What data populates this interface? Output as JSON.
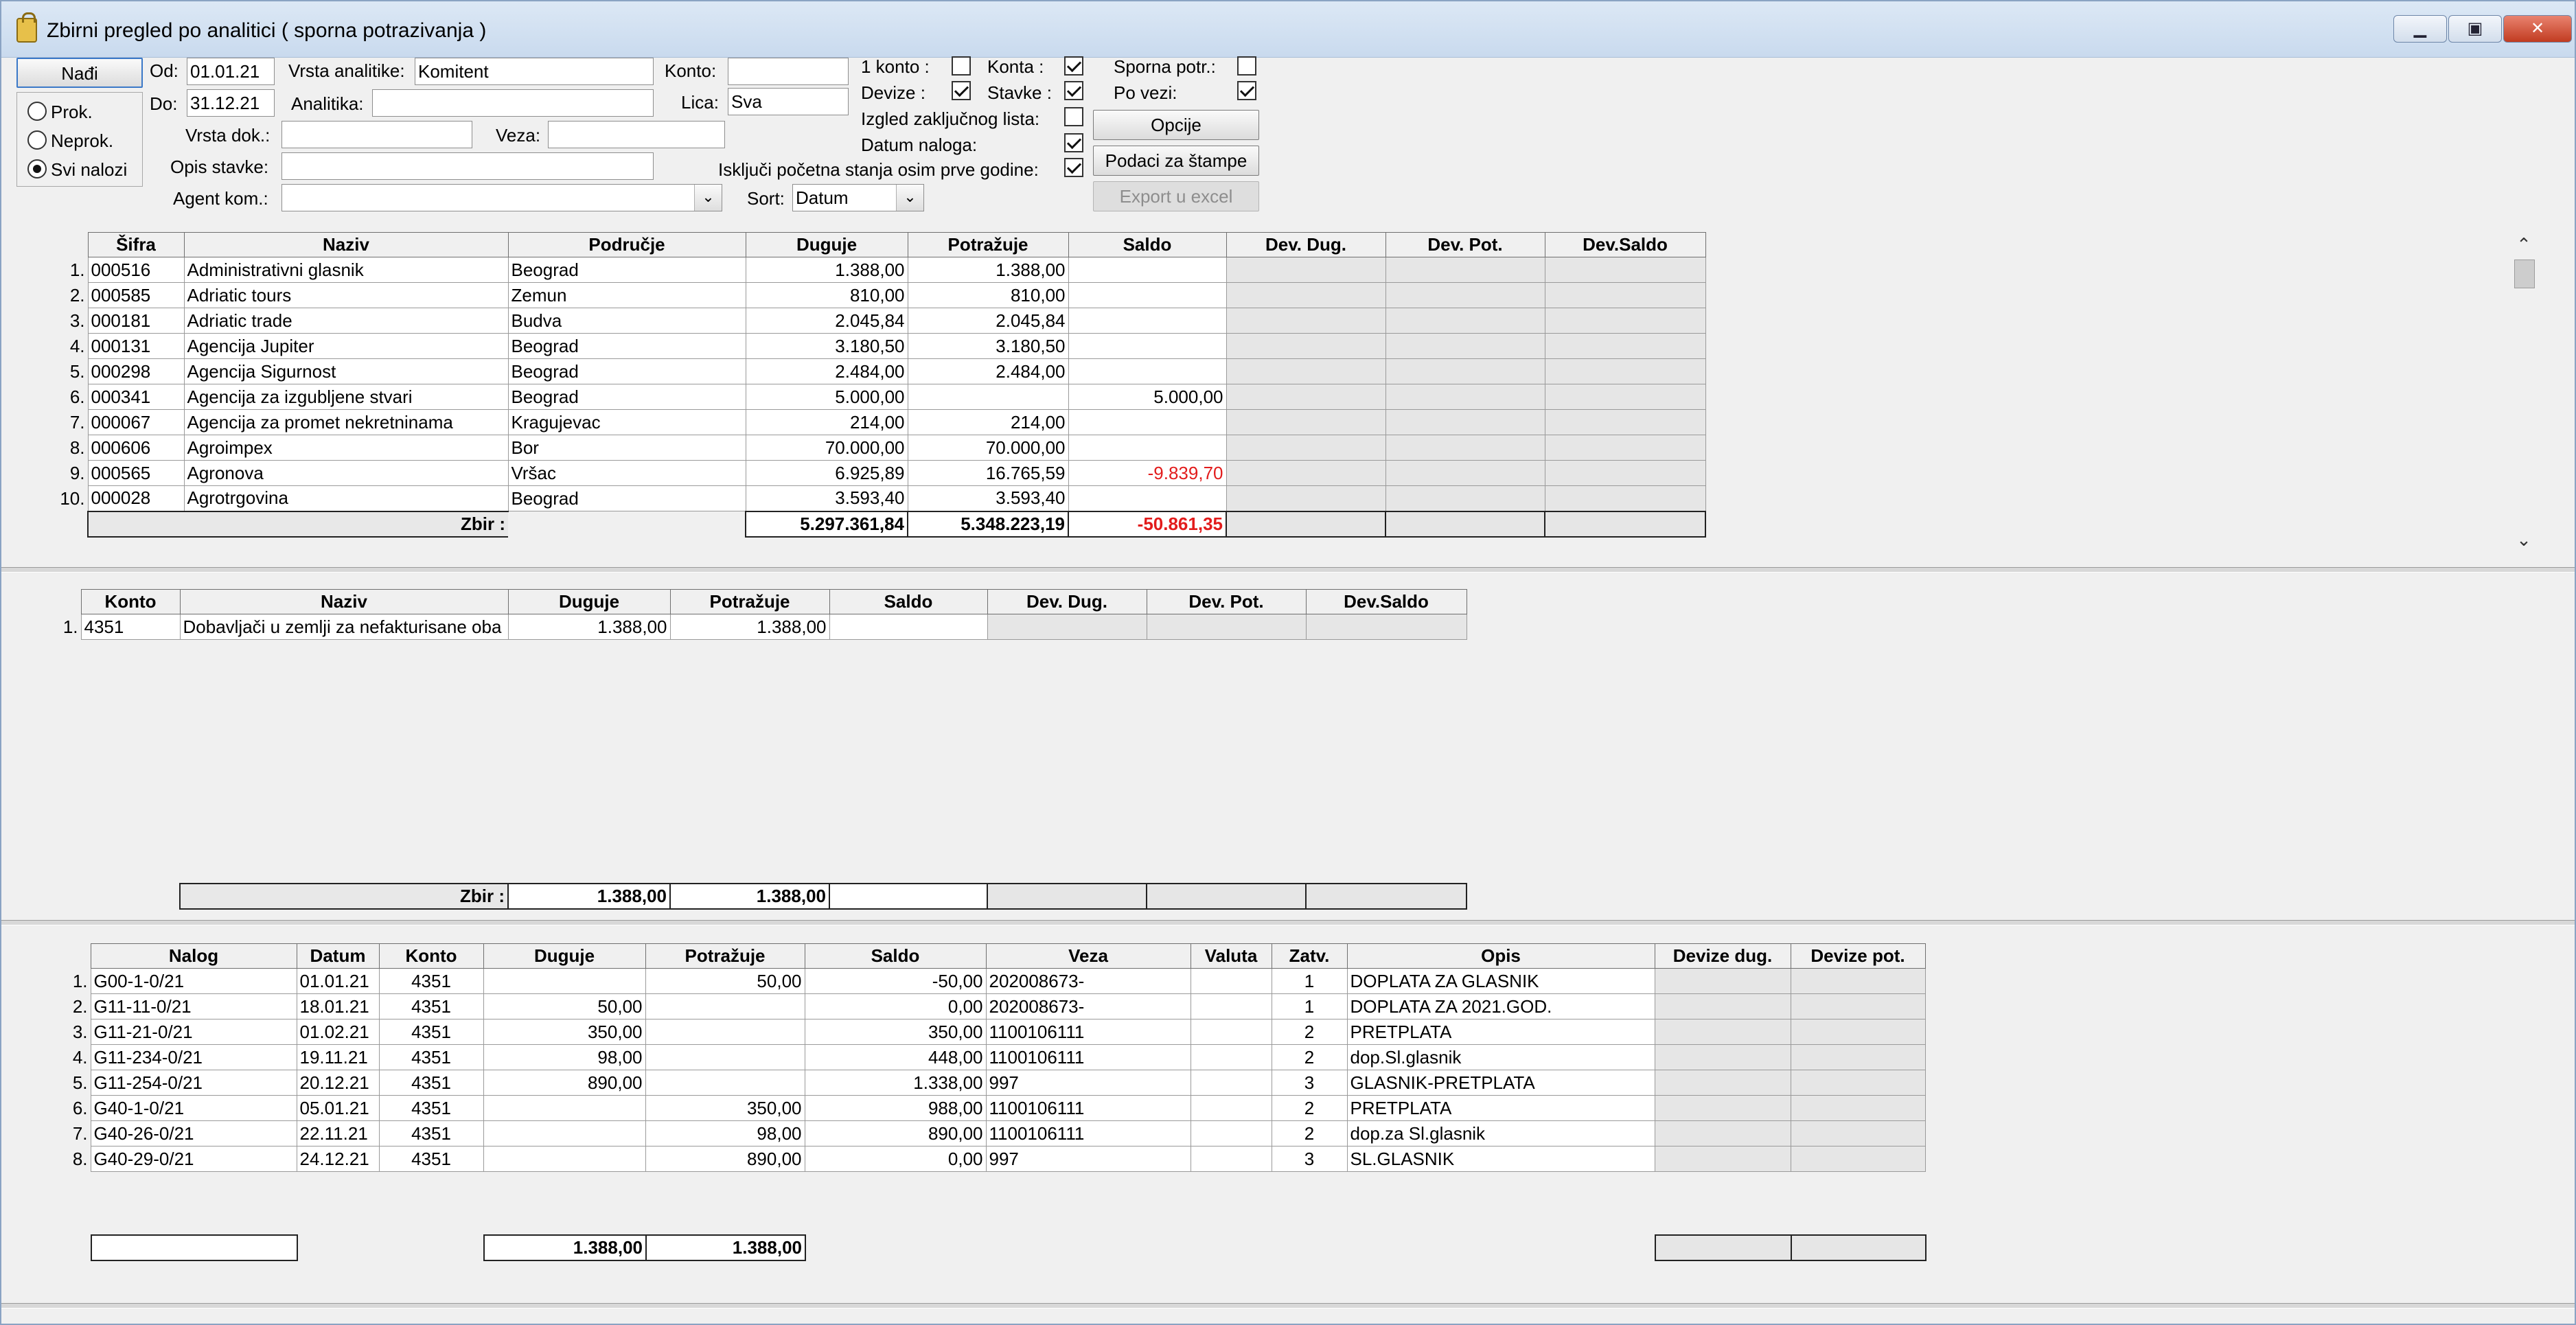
{
  "window": {
    "title": "Zbirni pregled po analitici  ( sporna potrazivanja )",
    "controls": [
      "minimize-icon",
      "maximize-icon",
      "close-icon"
    ]
  },
  "filters": {
    "find_button": "Nađi",
    "od_label": "Od:",
    "od_value": "01.01.21",
    "do_label": "Do:",
    "do_value": "31.12.21",
    "radios": [
      {
        "label": "Prok.",
        "checked": false
      },
      {
        "label": "Neprok.",
        "checked": false
      },
      {
        "label": "Svi nalozi",
        "checked": true
      }
    ],
    "vrsta_analitike_label": "Vrsta analitike:",
    "vrsta_analitike_value": "Komitent",
    "analitika_label": "Analitika:",
    "analitika_value": "",
    "vrsta_dok_label": "Vrsta dok.:",
    "vrsta_dok_value": "",
    "veza_label": "Veza:",
    "veza_value": "",
    "opis_stavke_label": "Opis stavke:",
    "opis_stavke_value": "",
    "agent_kom_label": "Agent kom.:",
    "agent_kom_value": "",
    "konto_label": "Konto:",
    "konto_value": "",
    "lica_label": "Lica:",
    "lica_value": "Sva",
    "sort_label": "Sort:",
    "sort_value": "Datum",
    "checks": {
      "jedan_konto": {
        "label": "1 konto :",
        "checked": false
      },
      "devize": {
        "label": "Devize :",
        "checked": true
      },
      "konta": {
        "label": "Konta :",
        "checked": true
      },
      "stavke": {
        "label": "Stavke :",
        "checked": true
      },
      "sporna_potr": {
        "label": "Sporna potr.:",
        "checked": false
      },
      "po_vezi": {
        "label": "Po vezi:",
        "checked": true
      },
      "izgled": {
        "label": "Izgled zaključnog lista:",
        "checked": false
      },
      "datum_naloga": {
        "label": "Datum naloga:",
        "checked": true
      },
      "iskljuci": {
        "label": "Isključi početna stanja osim prve godine:",
        "checked": true
      }
    },
    "opcije_button": "Opcije",
    "podaci_button": "Podaci za štampe",
    "export_button": "Export u excel"
  },
  "grid1": {
    "headers": [
      "Šifra",
      "Naziv",
      "Područje",
      "Duguje",
      "Potražuje",
      "Saldo",
      "Dev. Dug.",
      "Dev. Pot.",
      "Dev.Saldo"
    ],
    "rows": [
      [
        "1.",
        "000516",
        "Administrativni glasnik",
        "Beograd",
        "1.388,00",
        "1.388,00",
        "",
        "",
        "",
        ""
      ],
      [
        "2.",
        "000585",
        "Adriatic tours",
        "Zemun",
        "810,00",
        "810,00",
        "",
        "",
        "",
        ""
      ],
      [
        "3.",
        "000181",
        "Adriatic trade",
        "Budva",
        "2.045,84",
        "2.045,84",
        "",
        "",
        "",
        ""
      ],
      [
        "4.",
        "000131",
        "Agencija Jupiter",
        "Beograd",
        "3.180,50",
        "3.180,50",
        "",
        "",
        "",
        ""
      ],
      [
        "5.",
        "000298",
        "Agencija Sigurnost",
        "Beograd",
        "2.484,00",
        "2.484,00",
        "",
        "",
        "",
        ""
      ],
      [
        "6.",
        "000341",
        "Agencija za izgubljene stvari",
        "Beograd",
        "5.000,00",
        "",
        "5.000,00",
        "",
        "",
        ""
      ],
      [
        "7.",
        "000067",
        "Agencija za promet nekretninama",
        "Kragujevac",
        "214,00",
        "214,00",
        "",
        "",
        "",
        ""
      ],
      [
        "8.",
        "000606",
        "Agroimpex",
        "Bor",
        "70.000,00",
        "70.000,00",
        "",
        "",
        "",
        ""
      ],
      [
        "9.",
        "000565",
        "Agronova",
        "Vršac",
        "6.925,89",
        "16.765,59",
        "-9.839,70",
        "",
        "",
        ""
      ],
      [
        "10.",
        "000028",
        "Agrotrgovina",
        "Beograd",
        "3.593,40",
        "3.593,40",
        "",
        "",
        "",
        ""
      ]
    ],
    "sum_label": "Zbir :",
    "sum": {
      "duguje": "5.297.361,84",
      "potrazuje": "5.348.223,19",
      "saldo": "-50.861,35"
    }
  },
  "grid2": {
    "headers": [
      "Konto",
      "Naziv",
      "Duguje",
      "Potražuje",
      "Saldo",
      "Dev. Dug.",
      "Dev. Pot.",
      "Dev.Saldo"
    ],
    "rows": [
      [
        "1.",
        "4351",
        "Dobavljači u zemlji za nefakturisane oba",
        "1.388,00",
        "1.388,00",
        "",
        "",
        "",
        ""
      ]
    ],
    "sum_label": "Zbir :",
    "sum": {
      "duguje": "1.388,00",
      "potrazuje": "1.388,00"
    }
  },
  "grid3": {
    "headers": [
      "Nalog",
      "Datum",
      "Konto",
      "Duguje",
      "Potražuje",
      "Saldo",
      "Veza",
      "Valuta",
      "Zatv.",
      "Opis",
      "Devize dug.",
      "Devize pot."
    ],
    "rows": [
      [
        "1.",
        "G00-1-0/21",
        "01.01.21",
        "4351",
        "",
        "50,00",
        "-50,00",
        "202008673-",
        "",
        "1",
        "DOPLATA ZA GLASNIK",
        "",
        ""
      ],
      [
        "2.",
        "G11-11-0/21",
        "18.01.21",
        "4351",
        "50,00",
        "",
        "0,00",
        "202008673-",
        "",
        "1",
        "DOPLATA ZA 2021.GOD.",
        "",
        ""
      ],
      [
        "3.",
        "G11-21-0/21",
        "01.02.21",
        "4351",
        "350,00",
        "",
        "350,00",
        "1100106111",
        "",
        "2",
        "PRETPLATA",
        "",
        ""
      ],
      [
        "4.",
        "G11-234-0/21",
        "19.11.21",
        "4351",
        "98,00",
        "",
        "448,00",
        "1100106111",
        "",
        "2",
        "dop.Sl.glasnik",
        "",
        ""
      ],
      [
        "5.",
        "G11-254-0/21",
        "20.12.21",
        "4351",
        "890,00",
        "",
        "1.338,00",
        "997",
        "",
        "3",
        "GLASNIK-PRETPLATA",
        "",
        ""
      ],
      [
        "6.",
        "G40-1-0/21",
        "05.01.21",
        "4351",
        "",
        "350,00",
        "988,00",
        "1100106111",
        "",
        "2",
        "PRETPLATA",
        "",
        ""
      ],
      [
        "7.",
        "G40-26-0/21",
        "22.11.21",
        "4351",
        "",
        "98,00",
        "890,00",
        "1100106111",
        "",
        "2",
        "dop.za Sl.glasnik",
        "",
        ""
      ],
      [
        "8.",
        "G40-29-0/21",
        "24.12.21",
        "4351",
        "",
        "890,00",
        "0,00",
        "997",
        "",
        "3",
        "SL.GLASNIK",
        "",
        ""
      ]
    ],
    "sum": {
      "duguje": "1.388,00",
      "potrazuje": "1.388,00"
    }
  }
}
